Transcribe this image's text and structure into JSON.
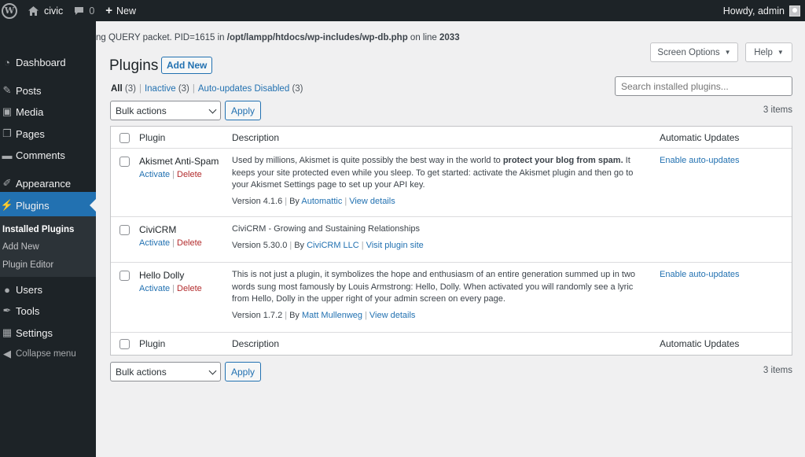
{
  "adminbar": {
    "logo": "W",
    "site_name": "civic",
    "comments_count": "0",
    "new_label": "New",
    "howdy": "Howdy, admin"
  },
  "sidebar": {
    "items": [
      {
        "label": "Dashboard",
        "icon": "dashboard-icon"
      },
      {
        "label": "Posts",
        "icon": "pin-icon"
      },
      {
        "label": "Media",
        "icon": "media-icon"
      },
      {
        "label": "Pages",
        "icon": "pages-icon"
      },
      {
        "label": "Comments",
        "icon": "comment-icon"
      },
      {
        "label": "Appearance",
        "icon": "brush-icon"
      },
      {
        "label": "Plugins",
        "icon": "plug-icon"
      },
      {
        "label": "Users",
        "icon": "user-icon"
      },
      {
        "label": "Tools",
        "icon": "wrench-icon"
      },
      {
        "label": "Settings",
        "icon": "settings-icon"
      },
      {
        "label": "Collapse menu",
        "icon": "collapse-icon"
      }
    ],
    "submenu": [
      "Installed Plugins",
      "Add New",
      "Plugin Editor"
    ]
  },
  "notice": {
    "part1": "ng QUERY packet. PID=1615 in ",
    "path": "/opt/lampp/htdocs/wp-includes/wp-db.php",
    "part2": " on line ",
    "line": "2033"
  },
  "header": {
    "title": "Plugins",
    "add_new": "Add New",
    "screen_options": "Screen Options",
    "help": "Help"
  },
  "filters": {
    "all": "All",
    "all_count": "(3)",
    "inactive": "Inactive",
    "inactive_count": "(3)",
    "auto": "Auto-updates Disabled",
    "auto_count": "(3)"
  },
  "search": {
    "placeholder": "Search installed plugins..."
  },
  "bulk": {
    "select_label": "Bulk actions",
    "apply": "Apply",
    "items": "3 items"
  },
  "table": {
    "columns": [
      "Plugin",
      "Description",
      "Automatic Updates"
    ],
    "actions": {
      "activate": "Activate",
      "delete": "Delete"
    },
    "rows": [
      {
        "name": "Akismet Anti-Spam",
        "desc_before": "Used by millions, Akismet is quite possibly the best way in the world to ",
        "desc_bold": "protect your blog from spam.",
        "desc_after": " It keeps your site protected even while you sleep. To get started: activate the Akismet plugin and then go to your Akismet Settings page to set up your API key.",
        "version": "Version 4.1.6",
        "by": "By",
        "author": "Automattic",
        "link": "View details",
        "auto": "Enable auto-updates"
      },
      {
        "name": "CiviCRM",
        "desc": "CiviCRM - Growing and Sustaining Relationships",
        "version": "Version 5.30.0",
        "by": "By",
        "author": "CiviCRM LLC",
        "link": "Visit plugin site",
        "auto": ""
      },
      {
        "name": "Hello Dolly",
        "desc": "This is not just a plugin, it symbolizes the hope and enthusiasm of an entire generation summed up in two words sung most famously by Louis Armstrong: Hello, Dolly. When activated you will randomly see a lyric from Hello, Dolly in the upper right of your admin screen on every page.",
        "version": "Version 1.7.2",
        "by": "By",
        "author": "Matt Mullenweg",
        "link": "View details",
        "auto": "Enable auto-updates"
      }
    ]
  },
  "colors": {
    "accent": "#2271b1",
    "sidebar": "#1d2327",
    "delete": "#b32d2e"
  }
}
